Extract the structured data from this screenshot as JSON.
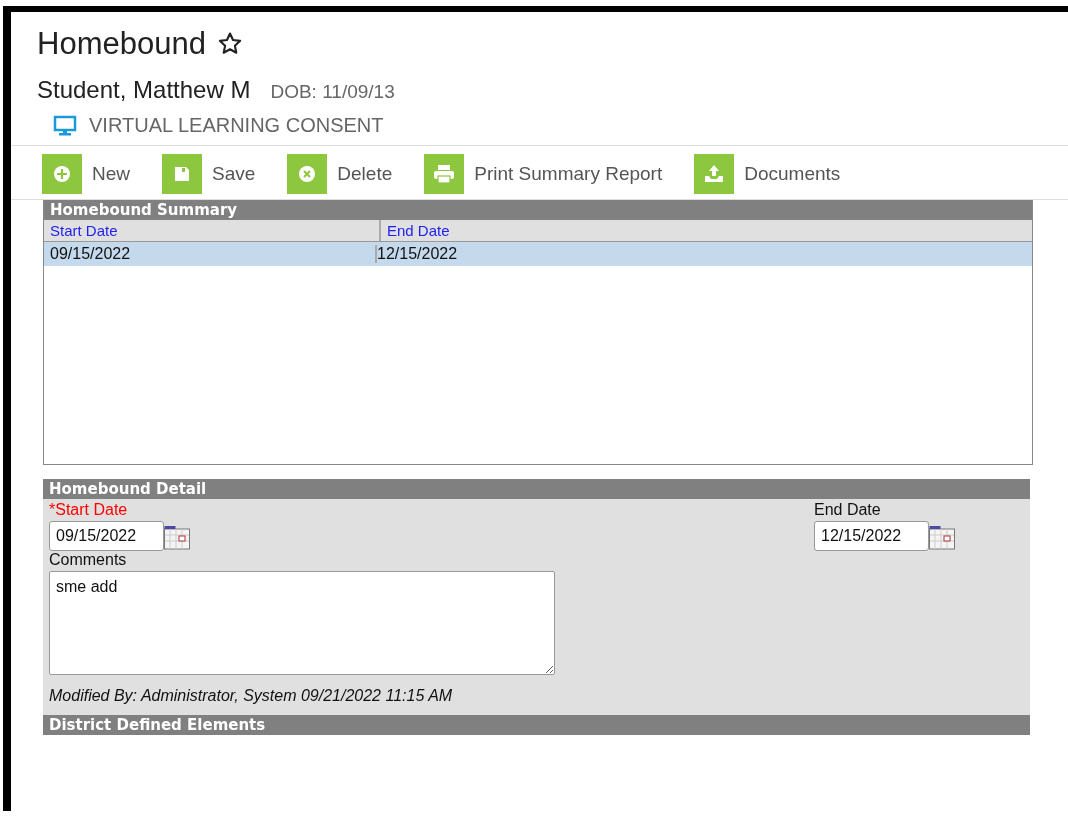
{
  "header": {
    "title": "Homebound",
    "student": "Student, Matthew M",
    "dob": "DOB: 11/09/13",
    "consent": "VIRTUAL LEARNING CONSENT"
  },
  "toolbar": [
    {
      "kind": "new",
      "label": "New"
    },
    {
      "kind": "save",
      "label": "Save"
    },
    {
      "kind": "delete",
      "label": "Delete"
    },
    {
      "kind": "print",
      "label": "Print Summary Report"
    },
    {
      "kind": "documents",
      "label": "Documents"
    }
  ],
  "summary": {
    "title": "Homebound Summary",
    "columns": [
      "Start Date",
      "End Date"
    ],
    "rows": [
      {
        "cells": [
          "09/15/2022",
          "12/15/2022"
        ],
        "selected": true
      }
    ]
  },
  "detail": {
    "title": "Homebound Detail",
    "start_label": "*Start Date",
    "start_value": "09/15/2022",
    "end_label": "End Date",
    "end_value": "12/15/2022",
    "comments_label": "Comments",
    "comments_value": "sme add",
    "modified": "Modified By: Administrator, System 09/21/2022 11:15 AM"
  },
  "district": {
    "title": "District Defined Elements"
  }
}
